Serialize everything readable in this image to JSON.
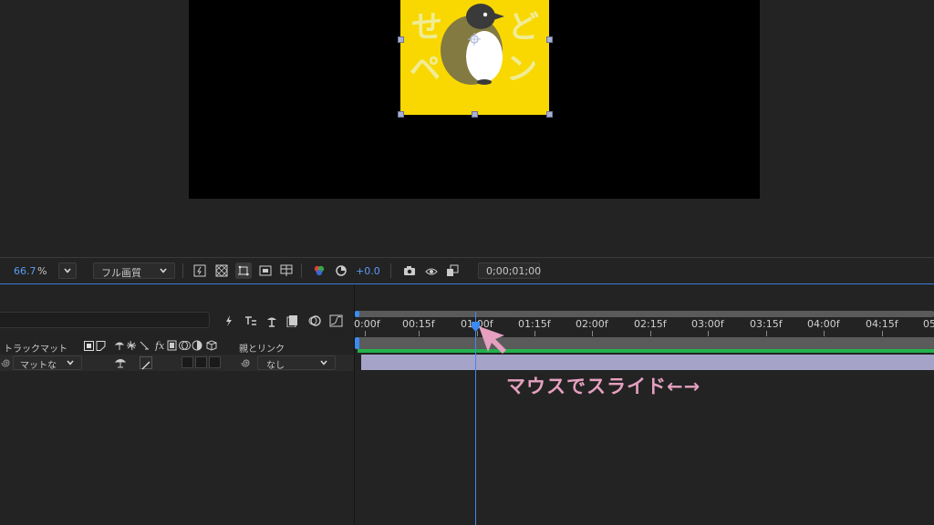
{
  "viewer": {
    "zoom_value": "66.7",
    "zoom_unit": "%",
    "resolution": "フル画質",
    "exposure_value": "+0.0",
    "timecode": "0;00;01;00"
  },
  "timeline": {
    "columns": {
      "track_matte": "トラックマット",
      "parent_link": "親とリンク"
    },
    "layer_row": {
      "matte_value": "マットな",
      "parent_value": "なし"
    },
    "ruler_labels": [
      "0:00f",
      "00:15f",
      "01:00f",
      "01:15f",
      "02:00f",
      "02:15f",
      "03:00f",
      "03:15f",
      "04:00f",
      "04:15f",
      "05"
    ],
    "current_time_label": "01:00f"
  },
  "annotation": {
    "text": "マウスでスライド←→",
    "color": "#e5a0c0"
  },
  "colors": {
    "accent_blue": "#3b7dd8",
    "layer_bar": "#a5a3c8",
    "work_area_green": "#22b14c",
    "layer_yellow": "#f8d800"
  },
  "icons": [
    "fast-preview-icon",
    "transparency-grid-icon",
    "mask-visibility-icon",
    "region-of-interest-icon",
    "grid-guides-icon",
    "channel-icon",
    "reset-exposure-icon",
    "snapshot-icon",
    "show-snapshot-icon",
    "layer-toggle-icon"
  ]
}
